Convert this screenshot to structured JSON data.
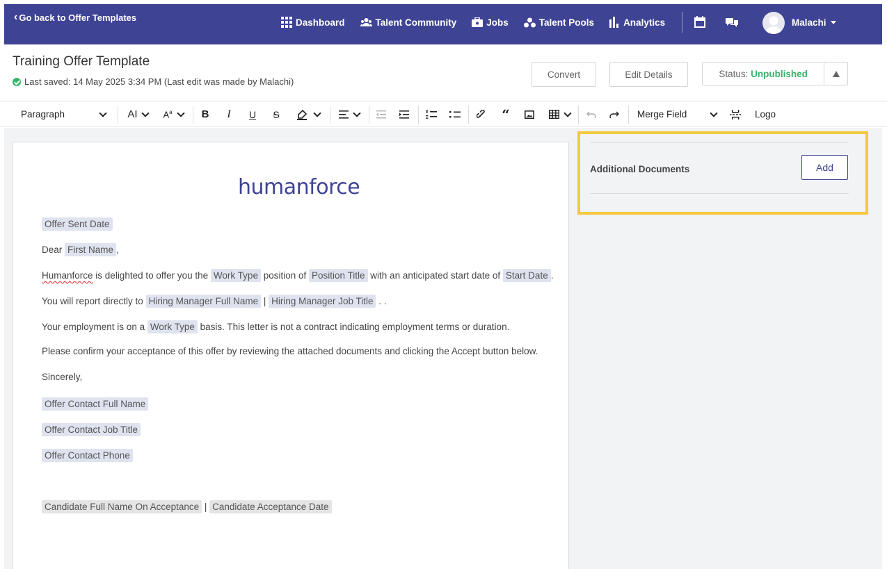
{
  "nav": {
    "back_label": "Go back to Offer Templates",
    "items": [
      {
        "label": "Dashboard",
        "icon": "grid-icon"
      },
      {
        "label": "Talent Community",
        "icon": "people-icon"
      },
      {
        "label": "Jobs",
        "icon": "briefcase-icon"
      },
      {
        "label": "Talent Pools",
        "icon": "nodes-icon"
      },
      {
        "label": "Analytics",
        "icon": "bar-chart-icon"
      }
    ],
    "user_name": "Malachi",
    "bar_color": "#3f4394"
  },
  "header": {
    "title": "Training Offer Template",
    "saved_text": "Last saved: 14 May 2025 3:34 PM (Last edit was made by Malachi)",
    "convert_label": "Convert",
    "edit_label": "Edit Details",
    "status_label": "Status:",
    "status_value": "Unpublished",
    "status_color": "#3bb36a"
  },
  "toolbar": {
    "block_format": "Paragraph",
    "font_size_label": "AI",
    "merge_field_label": "Merge Field",
    "logo_label": "Logo"
  },
  "document": {
    "logo_text": "humanforce",
    "offer_sent_date": "Offer Sent Date",
    "dear": "Dear",
    "first_name": "First Name",
    "comma": ",",
    "p1_company": "Humanforce",
    "p1_a": " is delighted to offer you the ",
    "work_type": "Work Type",
    "p1_b": " position of ",
    "position_title": "Position Title",
    "p1_c": " with an anticipated start date of ",
    "start_date": "Start Date",
    "p1_end": ".",
    "p2_a": "You will report directly to ",
    "hiring_manager_name": "Hiring Manager Full Name",
    "pipe": " | ",
    "hiring_manager_title": "Hiring Manager Job Title",
    "p2_end": " . .",
    "p3_a": "Your employment is on a ",
    "p3_b": " basis. This letter is not a contract indicating employment terms or duration.",
    "p4": "Please confirm your acceptance of this offer by reviewing the attached documents and clicking the Accept button below.",
    "sincerely": "Sincerely,",
    "contact_name": "Offer Contact Full Name",
    "contact_title": "Offer Contact Job Title",
    "contact_phone": "Offer Contact Phone",
    "candidate_name": "Candidate Full Name On Acceptance",
    "candidate_date": "Candidate Acceptance Date"
  },
  "side_panel": {
    "label": "Additional Documents",
    "add_label": "Add",
    "highlight_color": "#f5c842"
  }
}
